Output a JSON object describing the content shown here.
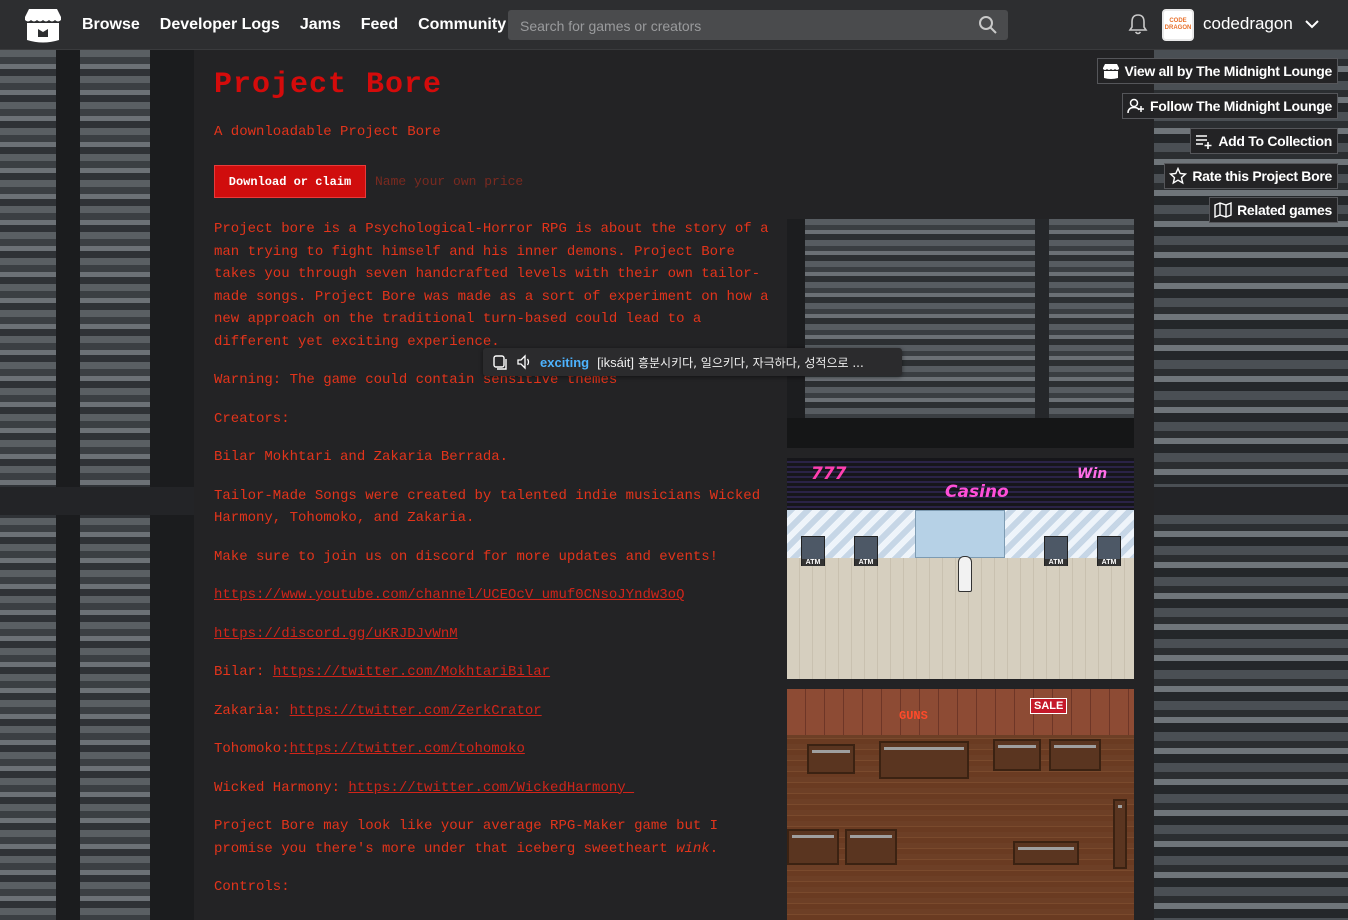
{
  "topnav": {
    "links": [
      "Browse",
      "Developer Logs",
      "Jams",
      "Feed",
      "Community"
    ],
    "search_placeholder": "Search for games or creators",
    "username": "codedragon",
    "avatar_text": "CODE DRAGON"
  },
  "game": {
    "title": "Project Bore",
    "subtitle": "A downloadable Project Bore",
    "download_label": "Download or claim",
    "price_hint": "Name your own price"
  },
  "description": {
    "p1": "Project bore is a Psychological-Horror RPG is about the story of a man trying to fight himself and his inner demons. Project Bore takes you through seven handcrafted levels with their own tailor-made songs. Project Bore was made as a sort of experiment on how a new approach on the traditional turn-based could lead to a different yet exciting experience.",
    "p2": "Warning: The game could contain sensitive themes",
    "p3": "Creators:",
    "p4": "Bilar Mokhtari and Zakaria Berrada.",
    "p5": "Tailor-Made Songs were created by talented indie musicians Wicked Harmony, Tohomoko, and Zakaria.",
    "p6": "Make sure to join us on discord for more updates and events!",
    "link_youtube": "https://www.youtube.com/channel/UCEOcV_umuf0CNsoJYndw3oQ",
    "link_discord": "https://discord.gg/uKRJDJvWnM",
    "bilar_label": "Bilar: ",
    "bilar_link": "https://twitter.com/MokhtariBilar",
    "zakaria_label": "Zakaria: ",
    "zakaria_link": "https://twitter.com/ZerkCrator",
    "tohomoko_label": "Tohomoko:",
    "tohomoko_link": "https://twitter.com/tohomoko",
    "wicked_label": "Wicked Harmony: ",
    "wicked_link": "https://twitter.com/WickedHarmony_",
    "p7_text": "Project Bore may look like your average RPG-Maker game but I promise you there's more under that iceberg sweetheart ",
    "p7_wink": "wink",
    "p7_end": ".",
    "controls": "Controls:"
  },
  "screenshots": {
    "casino_sign": "Casino",
    "sign_777": "777",
    "sign_win": "Win",
    "atm_label": "ATM",
    "sale_label": "SALE",
    "guns_label": "GUNS"
  },
  "sidebar": {
    "view_all": "View all by The Midnight Lounge",
    "follow": "Follow The Midnight Lounge",
    "add_collection": "Add To Collection",
    "rate": "Rate this Project Bore",
    "related": "Related games"
  },
  "tooltip": {
    "word": "exciting",
    "pronunciation": "[iksáit]",
    "definition": "흥분시키다, 일으키다, 자극하다, 성적으로 ..."
  },
  "colors": {
    "accent": "#d40b0b",
    "text": "#e3341b",
    "page_bg": "#232325"
  }
}
